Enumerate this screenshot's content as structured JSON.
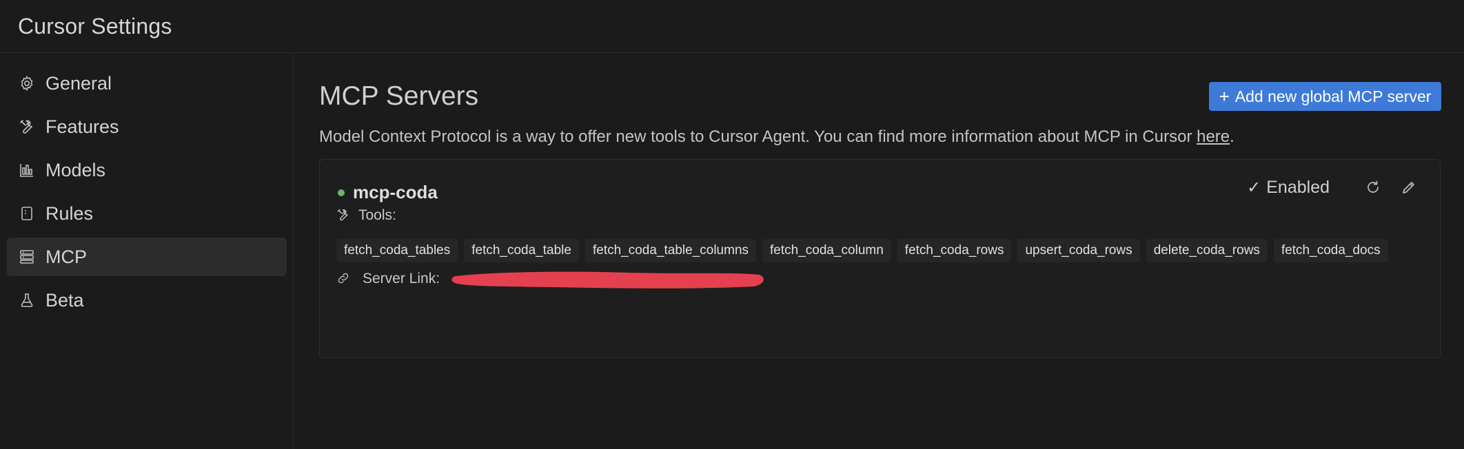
{
  "window": {
    "title": "Cursor Settings"
  },
  "sidebar": {
    "items": [
      {
        "label": "General",
        "icon": "gear-icon"
      },
      {
        "label": "Features",
        "icon": "tools-icon"
      },
      {
        "label": "Models",
        "icon": "bar-chart-icon"
      },
      {
        "label": "Rules",
        "icon": "document-icon"
      },
      {
        "label": "MCP",
        "icon": "server-icon",
        "active": true
      },
      {
        "label": "Beta",
        "icon": "flask-icon"
      }
    ]
  },
  "main": {
    "title": "MCP Servers",
    "add_button_label": "Add new global MCP server",
    "description_text": "Model Context Protocol is a way to offer new tools to Cursor Agent. You can find more information about MCP in Cursor ",
    "description_link": "here",
    "description_end": ".",
    "server": {
      "name": "mcp-coda",
      "status": "active",
      "status_color": "#6ab76d",
      "enabled_label": "Enabled",
      "tools_label": "Tools:",
      "tools": [
        "fetch_coda_tables",
        "fetch_coda_table",
        "fetch_coda_table_columns",
        "fetch_coda_column",
        "fetch_coda_rows",
        "upsert_coda_rows",
        "delete_coda_rows",
        "fetch_coda_docs"
      ],
      "server_link_label": "Server Link:",
      "server_link_redacted": true
    }
  },
  "colors": {
    "background": "#1b1b1b",
    "accent": "#3e7ad8",
    "redaction": "#e5404f"
  }
}
